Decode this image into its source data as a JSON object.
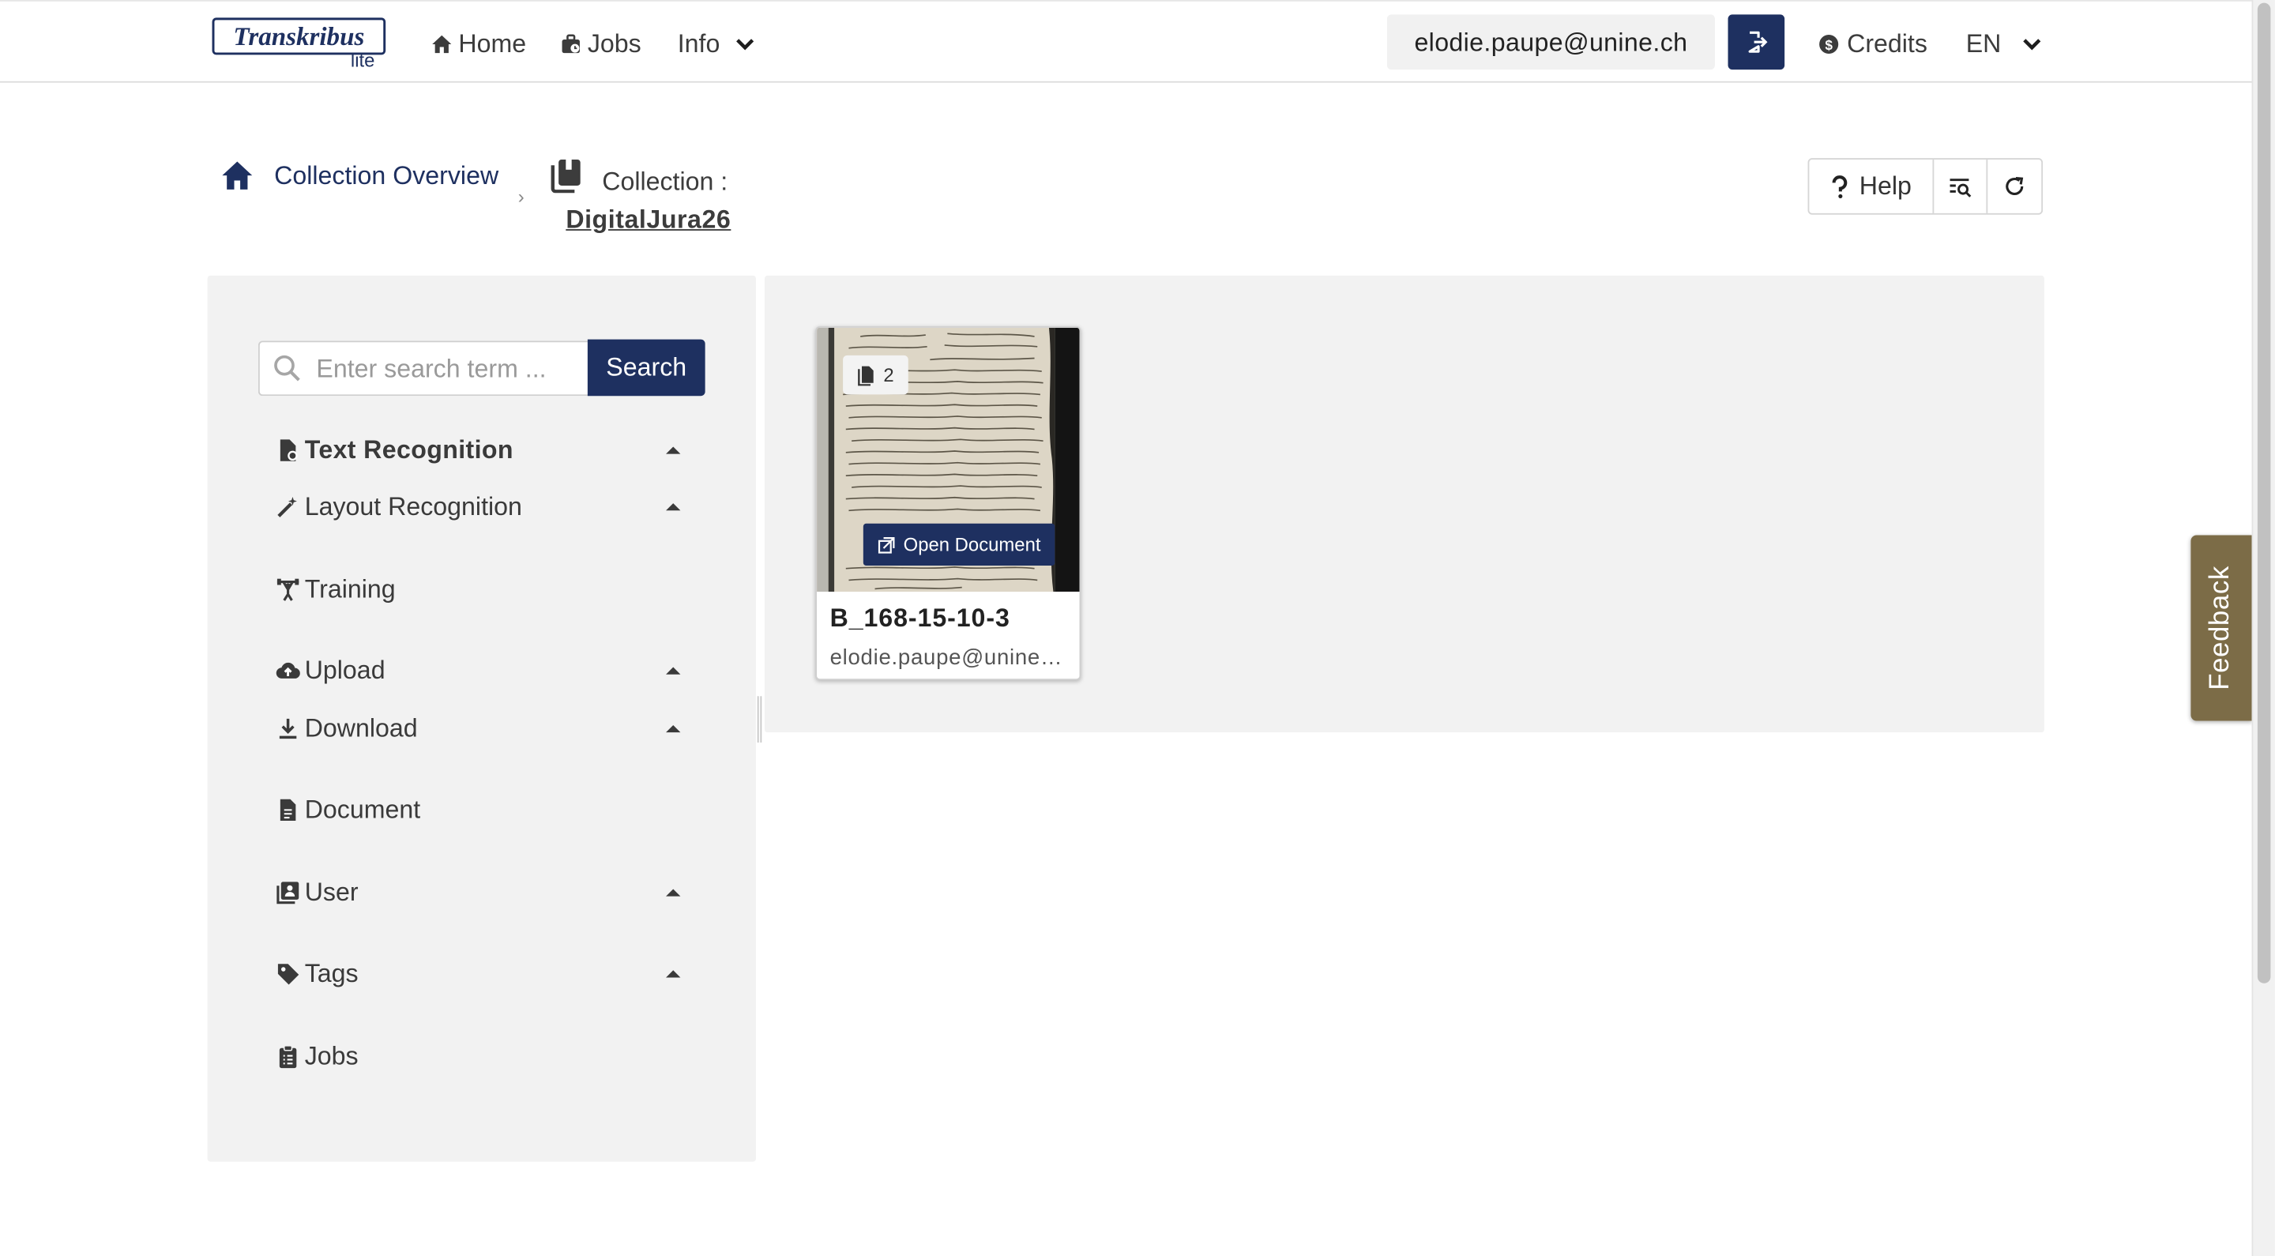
{
  "header": {
    "logo_text": "Transkribus",
    "logo_sub": "lite",
    "nav": {
      "home": "Home",
      "jobs": "Jobs",
      "info": "Info"
    },
    "user_email": "elodie.paupe@unine.ch",
    "credits": "Credits",
    "language": "EN"
  },
  "breadcrumb": {
    "overview": "Collection Overview",
    "separator": "›",
    "collection_label": "Collection :",
    "collection_name": "DigitalJura26"
  },
  "toolbar": {
    "help": "Help"
  },
  "sidebar": {
    "search_placeholder": "Enter search term ...",
    "search_button": "Search",
    "items": {
      "text_recognition": "Text Recognition",
      "layout_recognition": "Layout Recognition",
      "training": "Training",
      "upload": "Upload",
      "download": "Download",
      "document": "Document",
      "user": "User",
      "tags": "Tags",
      "jobs": "Jobs"
    }
  },
  "documents": [
    {
      "title": "B_168-15-10-3",
      "owner": "elodie.paupe@unine.ch",
      "page_count": "2",
      "open_label": "Open Document"
    }
  ],
  "feedback_label": "Feedback",
  "colors": {
    "primary": "#1e3060",
    "panel_bg": "#f2f2f2",
    "feedback_bg": "#7c6c47"
  }
}
